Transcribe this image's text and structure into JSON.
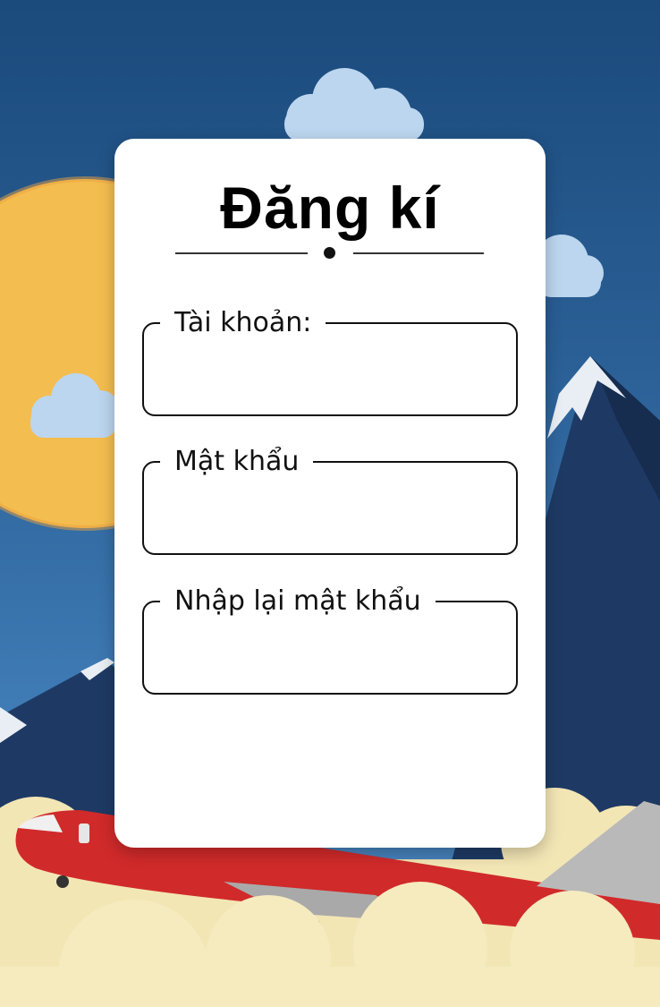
{
  "form": {
    "title": "Đăng kí",
    "fields": [
      {
        "label": "Tài khoản:",
        "value": ""
      },
      {
        "label": "Mật khẩu",
        "value": ""
      },
      {
        "label": "Nhập lại mật khẩu",
        "value": ""
      }
    ]
  },
  "colors": {
    "sky": "#2a5f95",
    "sun": "#f5c152",
    "mountain": "#1f3c66",
    "plane": "#d12a2a",
    "cloud_light": "#bcd6ef",
    "cloud_ground": "#f3e6b5"
  }
}
